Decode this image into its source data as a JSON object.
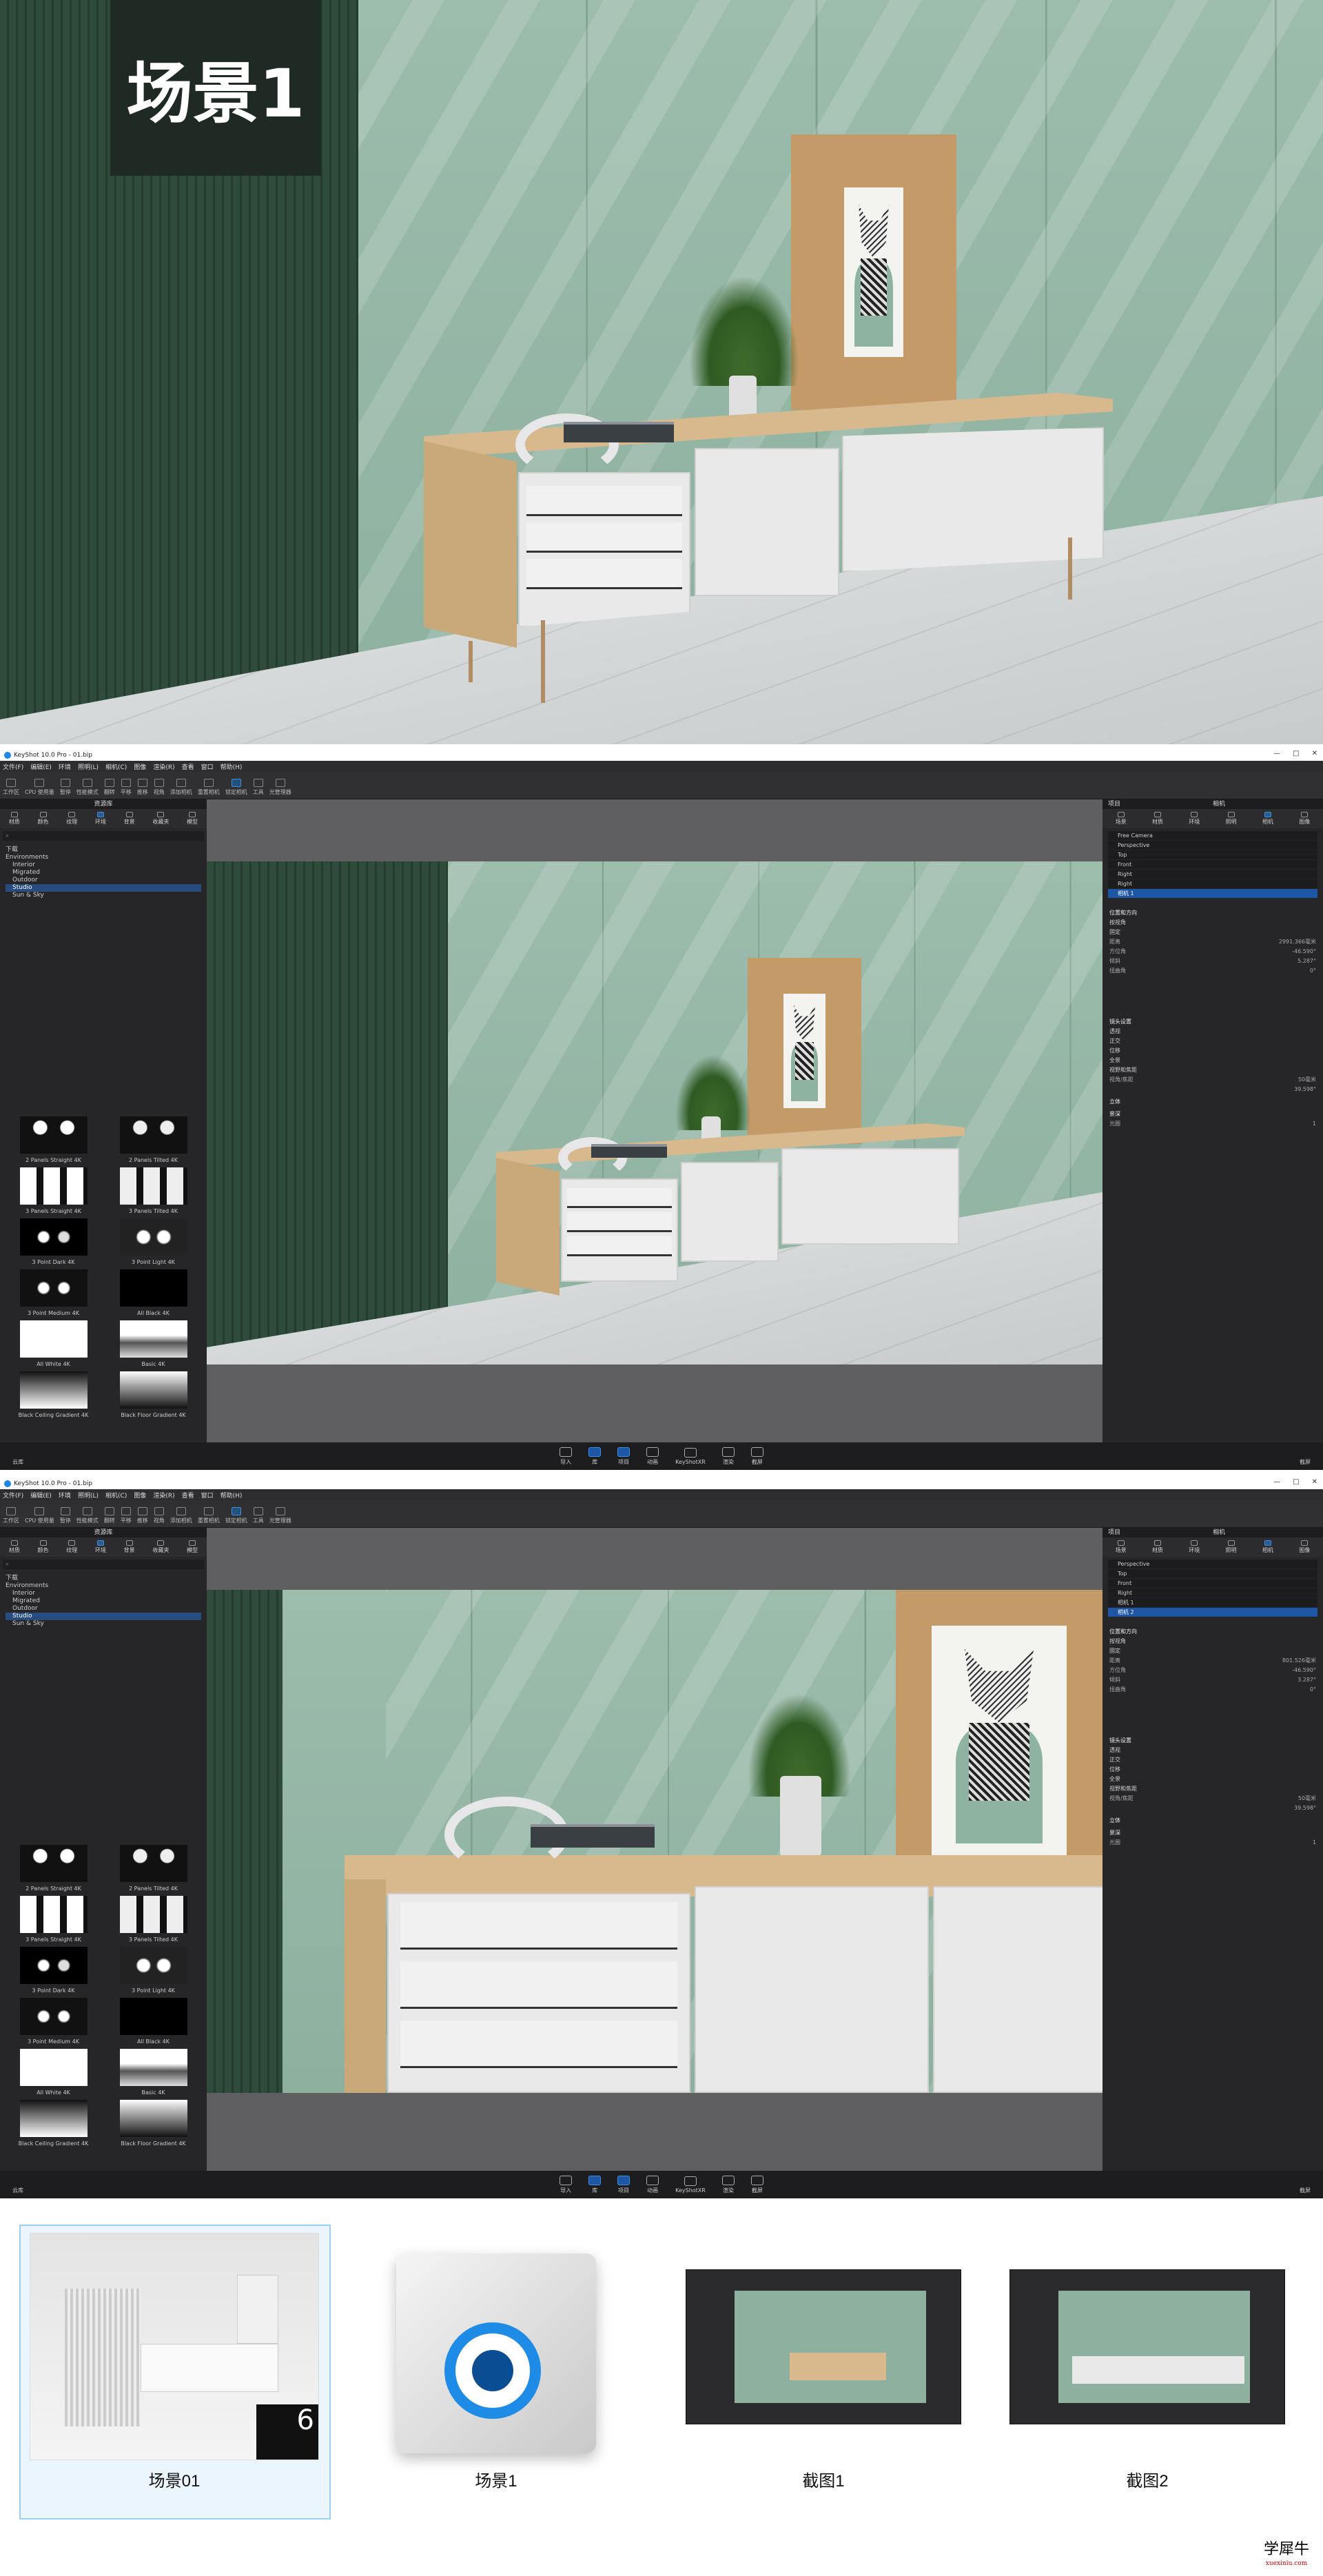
{
  "hero": {
    "title": "场景1"
  },
  "app": {
    "window_title": "KeyShot 10.0 Pro - 01.bip",
    "window_buttons": [
      "—",
      "□",
      "✕"
    ],
    "menu": [
      "文件(F)",
      "编辑(E)",
      "环境",
      "照明(L)",
      "相机(C)",
      "图像",
      "渲染(R)",
      "查看",
      "窗口",
      "帮助(H)"
    ],
    "toolbar": [
      "工作区",
      "CPU 使用量",
      "暂停",
      "性能模式",
      "翻转",
      "平移",
      "推移",
      "视角",
      "添加相机",
      "重置相机",
      "锁定相机",
      "工具",
      "光管理器"
    ],
    "library": {
      "title": "资源库",
      "tabs": [
        "材质",
        "颜色",
        "纹理",
        "环境",
        "背景",
        "收藏夹",
        "模型"
      ],
      "search_placeholder": "",
      "tree_root": "下载",
      "tree": [
        "Environments",
        "Interior",
        "Migrated",
        "Outdoor",
        "Studio",
        "Sun & Sky"
      ],
      "selected": "Studio",
      "thumbnails": [
        "2 Panels Straight 4K",
        "2 Panels Tilted 4K",
        "3 Panels Straight 4K",
        "3 Panels Tilted 4K",
        "3 Point Dark 4K",
        "3 Point Light 4K",
        "3 Point Medium 4K",
        "All Black 4K",
        "All White 4K",
        "Basic 4K",
        "Black Ceiling Gradient 4K",
        "Black Floor Gradient 4K"
      ]
    },
    "camera_panel": {
      "title": "项目",
      "subtitle": "相机",
      "tabs": [
        "场景",
        "材质",
        "环境",
        "照明",
        "相机",
        "图像"
      ],
      "section_position": "位置和方向",
      "options": [
        "按视角",
        "固定",
        "距离",
        "方位角",
        "倾斜",
        "扭曲角"
      ],
      "values": [
        "2991.366毫米",
        "-46.590°",
        "5.287°",
        "0°"
      ],
      "lens_section": "镜头设置",
      "lens_options": [
        "透视",
        "正交",
        "位移",
        "全景",
        "视野和焦距"
      ],
      "fov_label": "视角/焦距",
      "fov_value": "50毫米",
      "fov_deg": "39.598°",
      "stereo": "立体",
      "dof": "景深",
      "zoom_label": "光圈",
      "zoom_value": "1"
    },
    "bottom_bar": {
      "left": "云库",
      "items": [
        "导入",
        "库",
        "项目",
        "动画",
        "KeyShotXR",
        "渲染",
        "截屏"
      ],
      "right": "截屏"
    }
  },
  "screen1": {
    "cameras": [
      "Free Camera",
      "Perspective",
      "Top",
      "Front",
      "Right",
      "Right",
      "相机 1"
    ],
    "selected_camera": "相机 1"
  },
  "screen2": {
    "cameras": [
      "Perspective",
      "Top",
      "Front",
      "Right",
      "相机 1",
      "相机 2"
    ],
    "selected_camera": "相机 2",
    "values": [
      "801.526毫米",
      "-46.590°",
      "3.287°",
      "0°"
    ]
  },
  "files": [
    {
      "name": "场景01",
      "type": "render"
    },
    {
      "name": "场景1",
      "type": "keyshot-package"
    },
    {
      "name": "截图1",
      "type": "screenshot"
    },
    {
      "name": "截图2",
      "type": "screenshot"
    }
  ],
  "watermark": {
    "text": "学犀牛",
    "sub": "xuexiniu.com"
  }
}
